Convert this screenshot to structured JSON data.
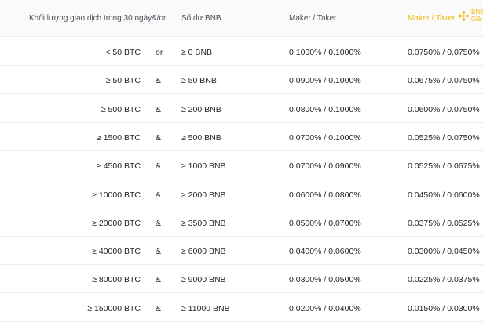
{
  "header": {
    "volume": "Khối lượng giao dịch trong 30 ngày",
    "and_or": "&/or",
    "bnb_balance": "Số dư BNB",
    "maker_taker": "Maker / Taker",
    "maker_taker_bnb": "Maker / Taker",
    "bnb_label": "BNB",
    "discount_label": "Giả"
  },
  "rows": [
    {
      "btc": "< 50 BTC",
      "op": "or",
      "bnb": "≥ 0 BNB",
      "mt": "0.1000% / 0.1000%",
      "mt_bnb": "0.0750% / 0.0750%"
    },
    {
      "btc": "≥ 50 BTC",
      "op": "&",
      "bnb": "≥ 50 BNB",
      "mt": "0.0900% / 0.1000%",
      "mt_bnb": "0.0675% / 0.0750%"
    },
    {
      "btc": "≥ 500 BTC",
      "op": "&",
      "bnb": "≥ 200 BNB",
      "mt": "0.0800% / 0.1000%",
      "mt_bnb": "0.0600% / 0.0750%"
    },
    {
      "btc": "≥ 1500 BTC",
      "op": "&",
      "bnb": "≥ 500 BNB",
      "mt": "0.0700% / 0.1000%",
      "mt_bnb": "0.0525% / 0.0750%"
    },
    {
      "btc": "≥ 4500 BTC",
      "op": "&",
      "bnb": "≥ 1000 BNB",
      "mt": "0.0700% / 0.0900%",
      "mt_bnb": "0.0525% / 0.0675%"
    },
    {
      "btc": "≥ 10000 BTC",
      "op": "&",
      "bnb": "≥ 2000 BNB",
      "mt": "0.0600% / 0.0800%",
      "mt_bnb": "0.0450% / 0.0600%"
    },
    {
      "btc": "≥ 20000 BTC",
      "op": "&",
      "bnb": "≥ 3500 BNB",
      "mt": "0.0500% / 0.0700%",
      "mt_bnb": "0.0375% / 0.0525%"
    },
    {
      "btc": "≥ 40000 BTC",
      "op": "&",
      "bnb": "≥ 6000 BNB",
      "mt": "0.0400% / 0.0600%",
      "mt_bnb": "0.0300% / 0.0450%"
    },
    {
      "btc": "≥ 80000 BTC",
      "op": "&",
      "bnb": "≥ 9000 BNB",
      "mt": "0.0300% / 0.0500%",
      "mt_bnb": "0.0225% / 0.0375%"
    },
    {
      "btc": "≥ 150000 BTC",
      "op": "&",
      "bnb": "≥ 11000 BNB",
      "mt": "0.0200% / 0.0400%",
      "mt_bnb": "0.0150% / 0.0300%"
    }
  ],
  "colors": {
    "accent": "#f0b90b",
    "border": "#eaecef",
    "text": "#1e2329",
    "header_bg": "#fafafa"
  }
}
